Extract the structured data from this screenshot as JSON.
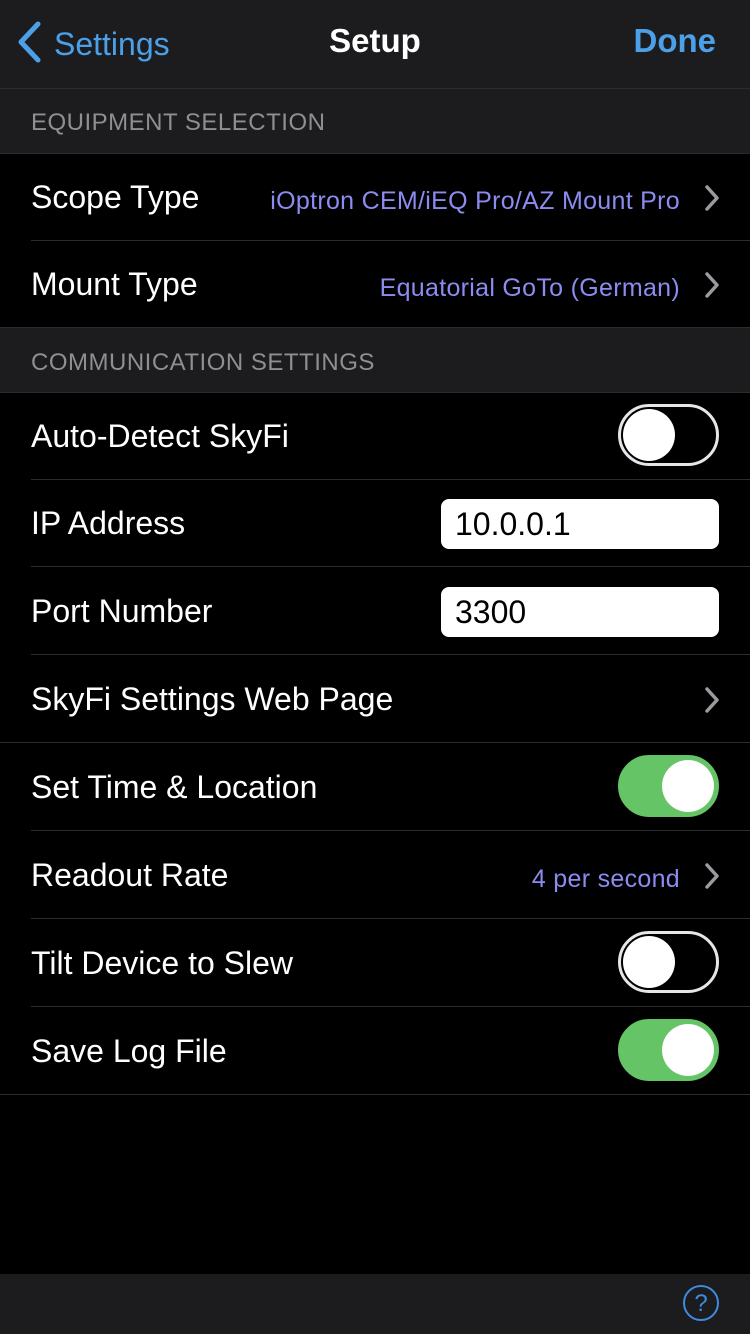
{
  "colors": {
    "accent": "#4ba0e8",
    "value_text": "#8c8cf0",
    "toggle_on": "#65c466",
    "help_accent": "#3d8be0"
  },
  "nav": {
    "back_label": "Settings",
    "back_icon": "chevron-left-icon",
    "title": "Setup",
    "done_label": "Done"
  },
  "sections": {
    "equipment": {
      "header": "EQUIPMENT SELECTION"
    },
    "communication": {
      "header": "COMMUNICATION SETTINGS"
    }
  },
  "rows": {
    "scope_type": {
      "label": "Scope Type",
      "value": "iOptron CEM/iEQ Pro/AZ Mount Pro"
    },
    "mount_type": {
      "label": "Mount Type",
      "value": "Equatorial GoTo (German)"
    },
    "auto_detect": {
      "label": "Auto-Detect SkyFi",
      "on": false
    },
    "ip_address": {
      "label": "IP Address",
      "value": "10.0.0.1"
    },
    "port_number": {
      "label": "Port Number",
      "value": "3300"
    },
    "skyfi_web": {
      "label": "SkyFi Settings Web Page"
    },
    "set_time": {
      "label": "Set Time & Location",
      "on": true
    },
    "readout_rate": {
      "label": "Readout Rate",
      "value": "4 per second"
    },
    "tilt_device": {
      "label": "Tilt Device to Slew",
      "on": false
    },
    "save_log": {
      "label": "Save Log File",
      "on": true
    }
  },
  "toolbar": {
    "help_label": "?",
    "help_icon": "help-icon"
  }
}
